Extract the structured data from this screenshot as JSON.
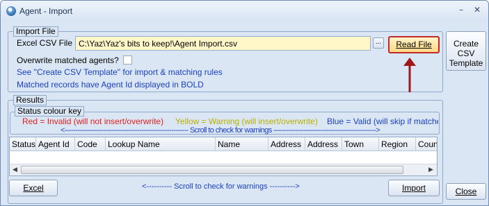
{
  "window": {
    "title": "Agent - Import",
    "minimize": "–",
    "close": "✕"
  },
  "import_file": {
    "group_label": "Import File",
    "csv_label": "Excel CSV File",
    "csv_path": "C:\\Yaz\\Yaz's bits to keep!\\Agent Import.csv",
    "browse_label": "...",
    "read_file_label": "Read File",
    "overwrite_label": "Overwrite matched agents?",
    "overwrite_checked": false,
    "hint_template": "See \"Create CSV Template\" for import & matching rules",
    "hint_bold": "Matched records have Agent Id displayed in BOLD",
    "accent_color": "#c0282a"
  },
  "side": {
    "create_template_label": "Create CSV Template",
    "close_label": "Close"
  },
  "results": {
    "group_label": "Results",
    "status_key_label": "Status colour key",
    "legend_red": "Red = Invalid (will not insert/overwrite)",
    "legend_yellow": "Yellow = Warning (will insert/overwrite)",
    "legend_blue": "Blue = Valid (will skip if matched",
    "scroll_hint_top": "<---------------------------------------------------------- Scroll to check for warnings ------------------------------------------------>",
    "columns": [
      "Status",
      "Agent Id",
      "Code",
      "Lookup Name",
      "Name",
      "Address",
      "Address",
      "Town",
      "Region",
      "Count"
    ],
    "colors": {
      "red": "#e02020",
      "yellow": "#b8b000",
      "blue": "#1a3fbf"
    }
  },
  "footer": {
    "excel_label": "Excel",
    "scroll_hint_bottom": "<---------- Scroll to check for warnings ---------->",
    "import_label": "Import"
  }
}
